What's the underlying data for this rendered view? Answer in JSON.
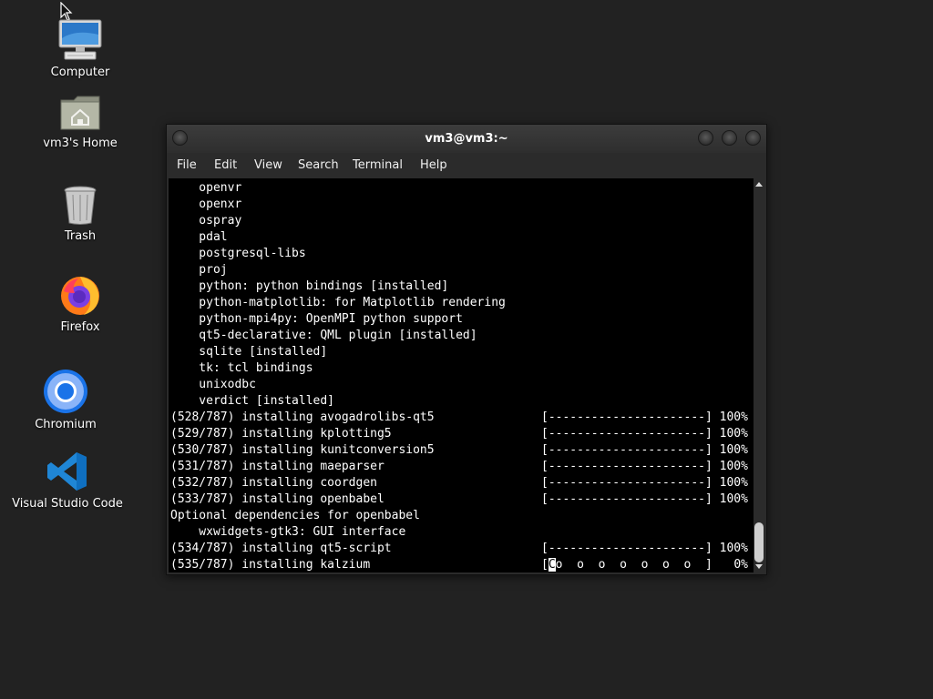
{
  "desktop": {
    "icons": [
      {
        "label": "Computer",
        "icon": "computer-icon"
      },
      {
        "label": "vm3's Home",
        "icon": "home-folder-icon"
      },
      {
        "label": "Trash",
        "icon": "trash-icon"
      },
      {
        "label": "Firefox",
        "icon": "firefox-icon"
      },
      {
        "label": "Chromium",
        "icon": "chromium-icon"
      },
      {
        "label": "Visual Studio Code",
        "icon": "vscode-icon"
      }
    ]
  },
  "window": {
    "title": "vm3@vm3:~",
    "menu": [
      "File",
      "Edit",
      "View",
      "Search",
      "Terminal",
      "Help"
    ]
  },
  "terminal": {
    "lines": [
      "    openvr",
      "    openxr",
      "    ospray",
      "    pdal",
      "    postgresql-libs",
      "    proj",
      "    python: python bindings [installed]",
      "    python-matplotlib: for Matplotlib rendering",
      "    python-mpi4py: OpenMPI python support",
      "    qt5-declarative: QML plugin [installed]",
      "    sqlite [installed]",
      "    tk: tcl bindings",
      "    unixodbc",
      "    verdict [installed]",
      "(528/787) installing avogadrolibs-qt5               [----------------------] 100%",
      "(529/787) installing kplotting5                     [----------------------] 100%",
      "(530/787) installing kunitconversion5               [----------------------] 100%",
      "(531/787) installing maeparser                      [----------------------] 100%",
      "(532/787) installing coordgen                       [----------------------] 100%",
      "(533/787) installing openbabel                      [----------------------] 100%",
      "Optional dependencies for openbabel",
      "    wxwidgets-gtk3: GUI interface",
      "(534/787) installing qt5-script                     [----------------------] 100%"
    ],
    "last_line_prefix": "(535/787) installing kalzium                        [",
    "last_line_cursor": "C",
    "last_line_suffix": "o  o  o  o  o  o  o  ]   0%"
  },
  "colors": {
    "desktop_bg": "#222222",
    "terminal_bg": "#000000",
    "terminal_fg": "#ffffff",
    "window_chrome": "#2b2b2b"
  }
}
